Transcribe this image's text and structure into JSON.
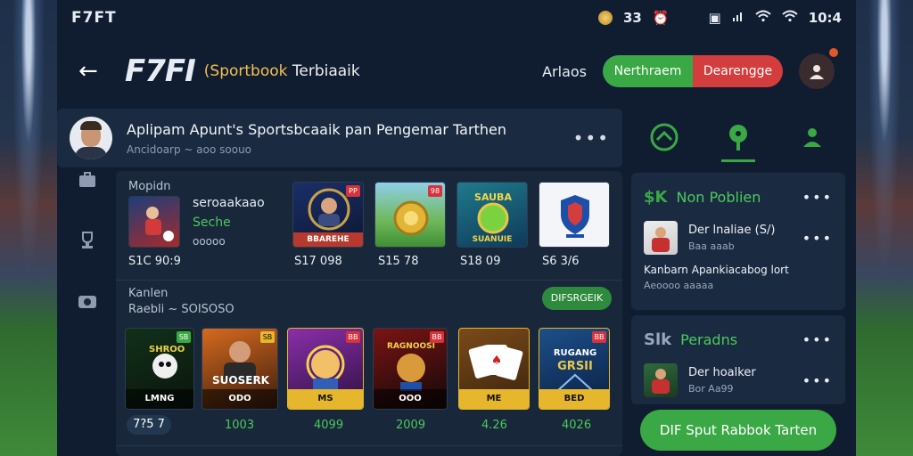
{
  "status_bar": {
    "brand": "F7FT",
    "coins": "33",
    "time": "10:4"
  },
  "header": {
    "logo": "F7FI",
    "logo_sub_accent": "(Sportbook",
    "logo_sub_rest": " Terbiaaik",
    "link": "Arlaos",
    "toggle_on": "Nerthraem",
    "toggle_off": "Dearengge"
  },
  "top_card": {
    "title": "Aplipam Apunt's Sportsbcaaik pan Pengemar Tarthen",
    "subtitle": "Ancidoarp ~ aoo soouo"
  },
  "featured": {
    "section_label": "Mopidn",
    "name": "seroaakaao",
    "status": "Seche",
    "code": "ooooo",
    "price": "S1C 90:9",
    "items": [
      {
        "caption": "BBAREHE",
        "corner": "PP",
        "price": "S17 098"
      },
      {
        "caption": "",
        "corner": "98",
        "price": "S15 78"
      },
      {
        "caption": "SUANUIE",
        "corner": "",
        "price": "S18 09"
      },
      {
        "caption": "",
        "corner": "",
        "price": "S6 3/6"
      }
    ]
  },
  "popular": {
    "section_label": "Kanlen",
    "sub_label": "Raebli ~ SOISOSO",
    "pill": "DIFSRGEIK",
    "items": [
      {
        "caption": "LMNG",
        "corner": "SB",
        "price": "7?5 7"
      },
      {
        "caption": "ODO",
        "corner": "SB",
        "price": "1003"
      },
      {
        "caption": "MS",
        "corner": "BB",
        "price": "4099"
      },
      {
        "caption": "OOO",
        "corner": "BB",
        "price": "2009"
      },
      {
        "caption": "ME",
        "corner": "",
        "price": "4.26"
      },
      {
        "caption": "BED",
        "corner": "BB",
        "price": "4026"
      }
    ]
  },
  "right_panel": {
    "card1": {
      "icon": "$K",
      "title": "Non Poblien",
      "row_name": "Der lnaliae  (S/)",
      "row_meta": "Baa aaab",
      "note": "Kanbarn Apankiacabog lort",
      "note_meta": "Aeoooo aaaaa"
    },
    "card2": {
      "icon": "Slk",
      "title": "Peradns",
      "row_name": "Der hoalker",
      "row_meta": "Bor Aa99"
    },
    "cta": "DIF Sput Rabbok Tarten"
  },
  "colors": {
    "accent_green": "#3aa845",
    "accent_red": "#d43d3d",
    "panel": "#1a2a40",
    "background": "#101d31"
  }
}
